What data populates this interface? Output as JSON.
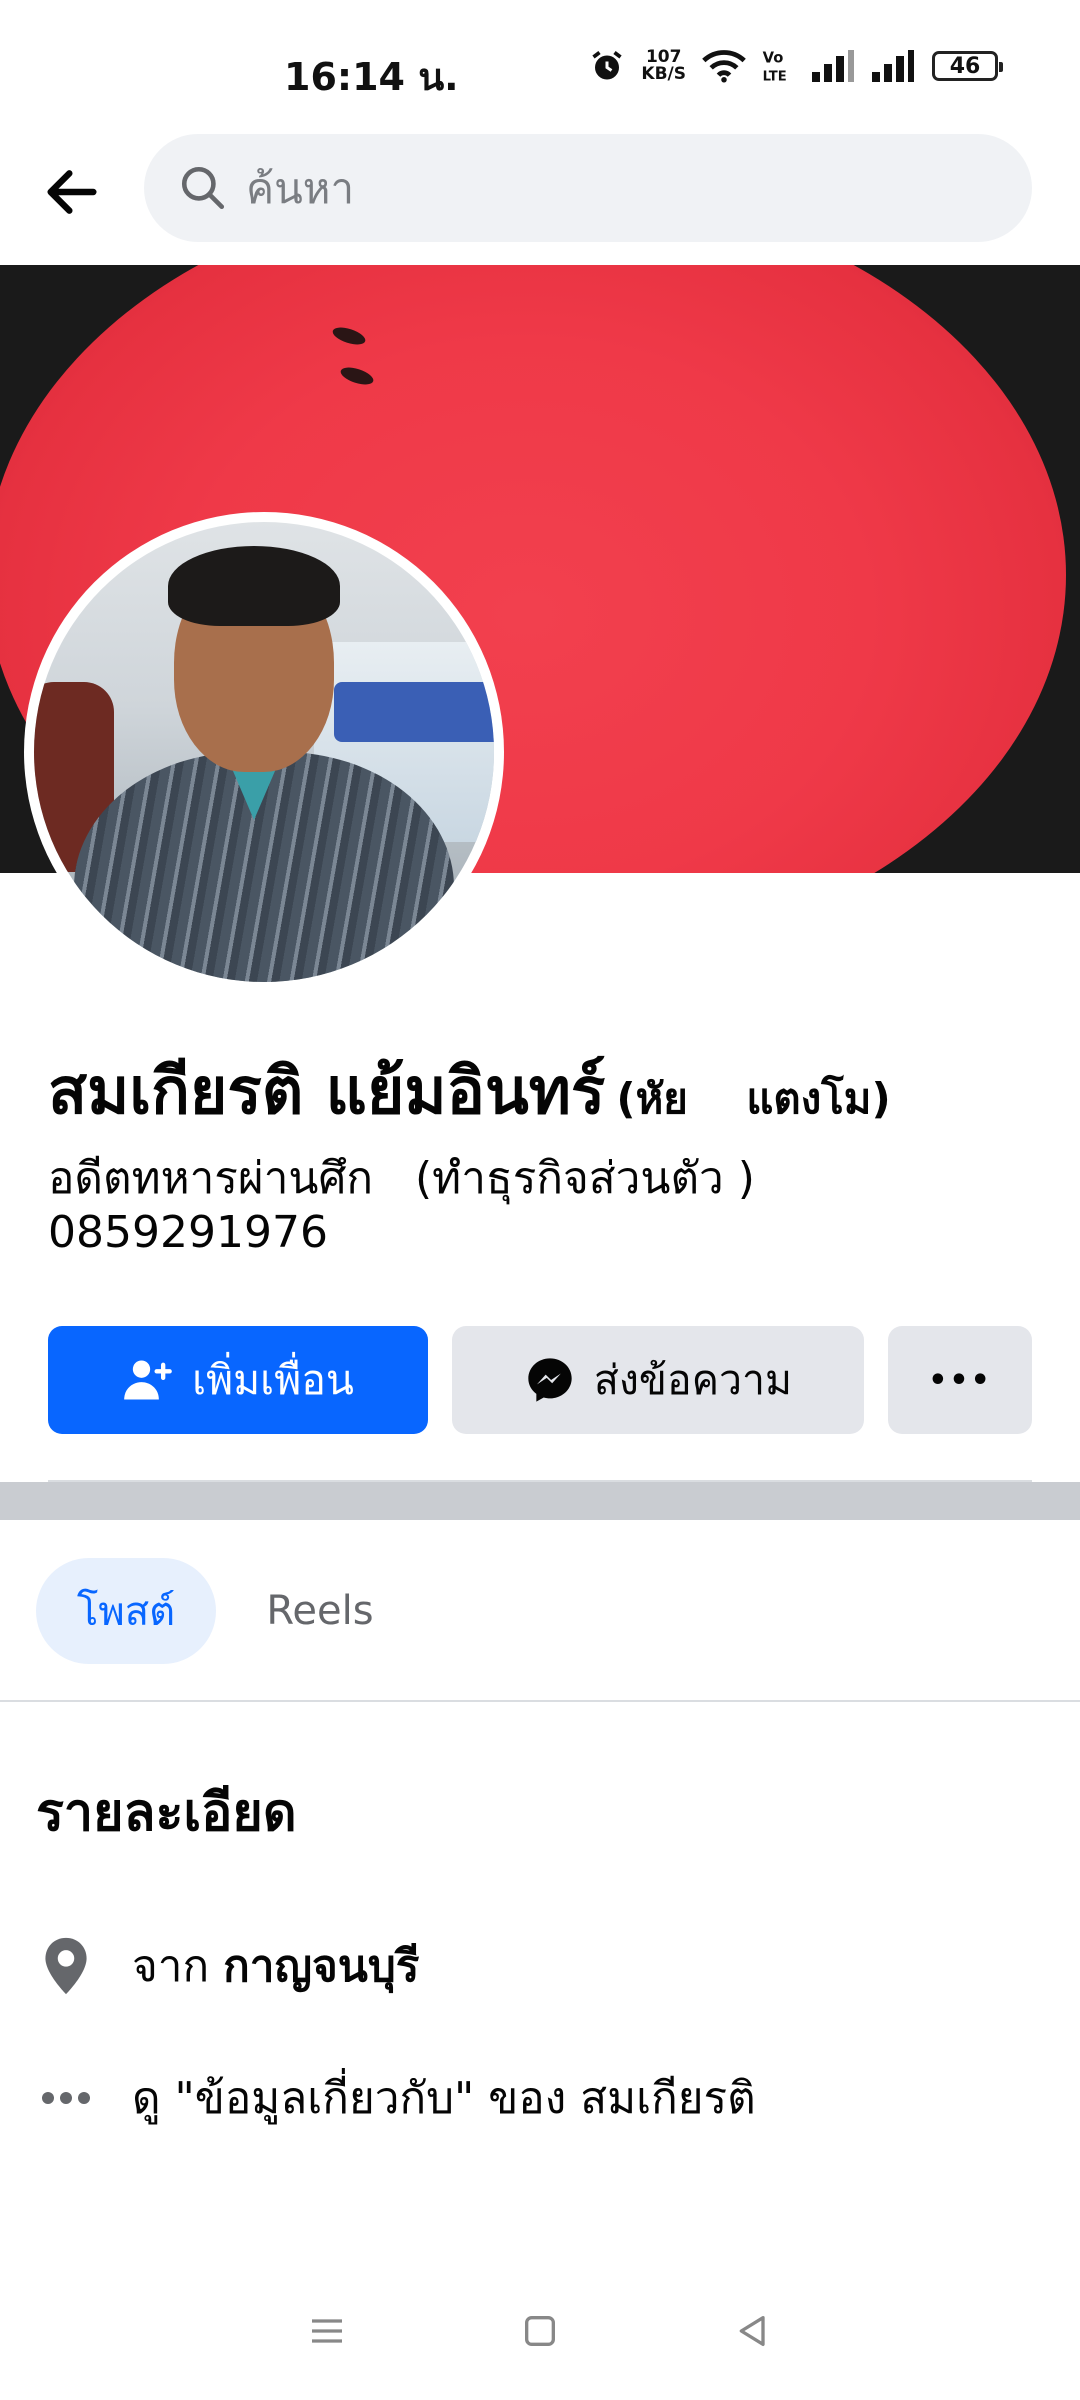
{
  "status_bar": {
    "time": "16:14 น.",
    "net_speed_value": "107",
    "net_speed_unit": "KB/S",
    "battery": "46"
  },
  "search": {
    "placeholder": "ค้นหา"
  },
  "profile": {
    "name": "สมเกียรติ แย้มอินทร์",
    "alternate_name": "(หัย    แตงโม)",
    "bio": "อดีตทหารผ่านศึก   (ทำธุรกิจส่วนตัว )\n0859291976"
  },
  "actions": {
    "add_friend": "เพิ่มเพื่อน",
    "message": "ส่งข้อความ",
    "more": "•••"
  },
  "tabs": [
    {
      "label": "โพสต์",
      "active": true
    },
    {
      "label": "Reels",
      "active": false
    }
  ],
  "details": {
    "title": "รายละเอียด",
    "from_prefix": "จาก",
    "from_place": "กาญจนบุรี",
    "about_link": "ดู \"ข้อมูลเกี่ยวกับ\" ของ สมเกียรติ"
  },
  "colors": {
    "accent": "#0866ff",
    "button_secondary": "#e4e6eb",
    "tab_active_bg": "#e7f0fd"
  },
  "icons": {
    "back": "arrow-left-icon",
    "search": "search-icon",
    "add_friend": "person-add-icon",
    "message": "messenger-icon",
    "location": "location-pin-icon",
    "about": "more-horizontal-icon"
  }
}
